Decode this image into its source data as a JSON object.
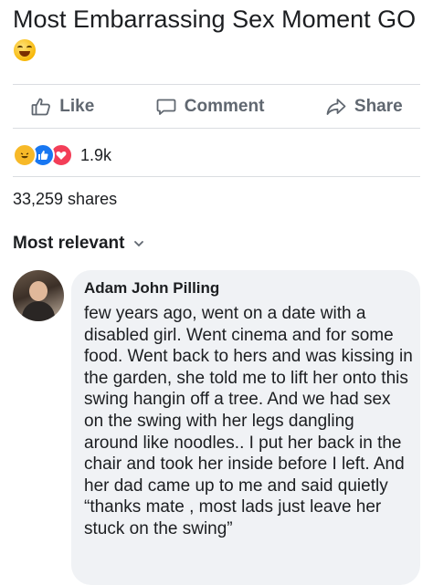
{
  "post": {
    "text": "Most Embarrassing Sex Moment GO",
    "emoji": "rolling-on-floor-laughing-emoji"
  },
  "actions": [
    {
      "label": "Like",
      "icon": "thumbs-up-icon"
    },
    {
      "label": "Comment",
      "icon": "comment-icon"
    },
    {
      "label": "Share",
      "icon": "share-arrow-icon"
    }
  ],
  "reactions": {
    "icons": [
      "haha-icon",
      "like-icon",
      "love-icon"
    ],
    "count": "1.9k"
  },
  "shares": "33,259 shares",
  "comments": {
    "sort_label": "Most relevant",
    "items": [
      {
        "author": "Adam John Pilling",
        "text": "few years ago, went on a date with a disabled girl. Went cinema and for some food. Went back to hers and was kissing in the garden, she told me to lift her onto this swing hangin off a tree. And we had sex on the swing with her legs dangling around like noodles.. I put her back in the chair and took her inside before I left. And her dad came up to me and said quietly “thanks mate , most lads just leave her stuck on the swing”"
      }
    ]
  },
  "colors": {
    "text": "#1c1e21",
    "secondary": "#606770",
    "bubble": "#f0f2f5",
    "like_blue": "#1877f2",
    "love_red": "#f33e58",
    "haha_yellow": "#f7b928"
  }
}
